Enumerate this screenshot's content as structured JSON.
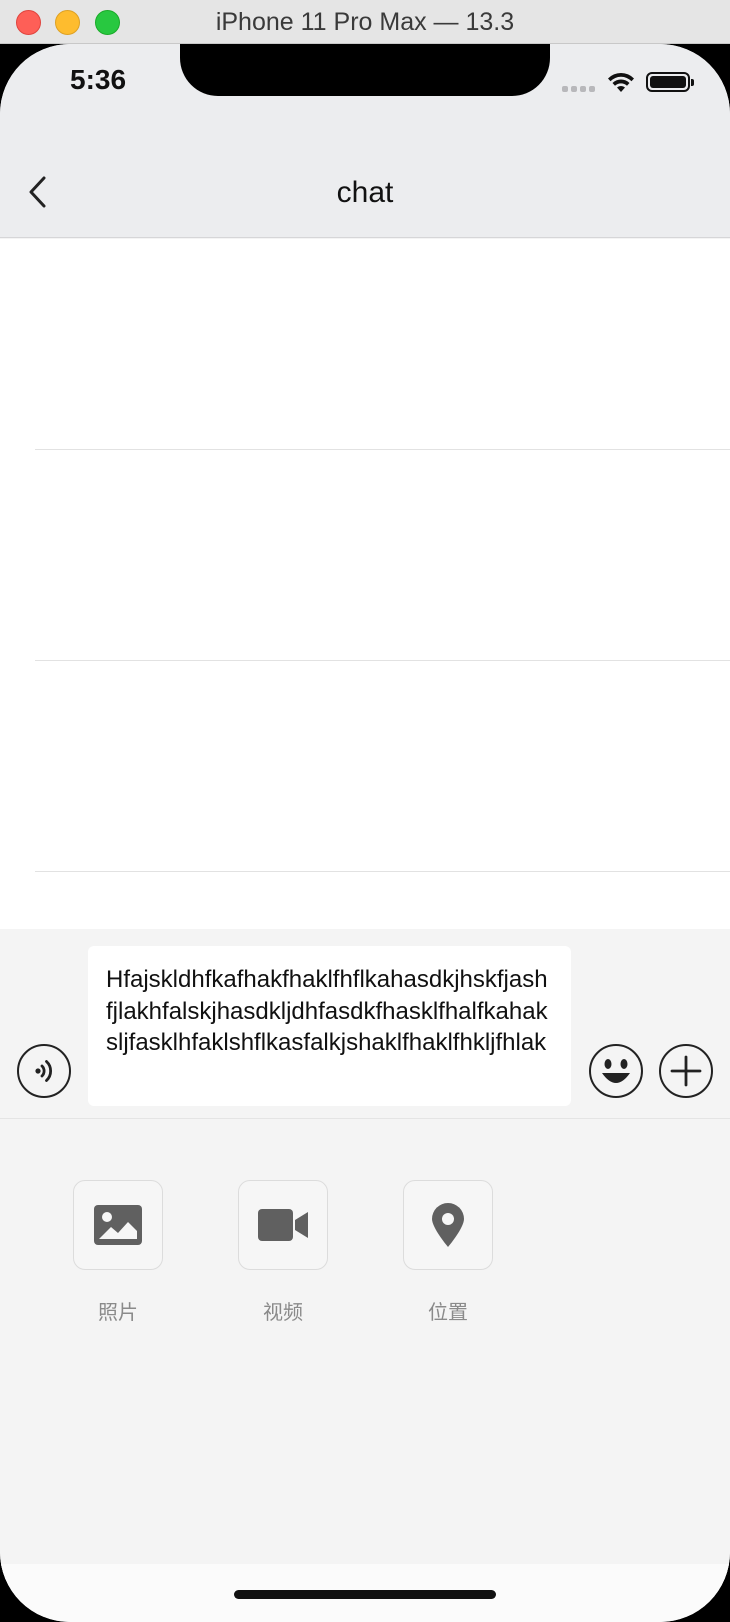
{
  "window": {
    "title": "iPhone 11 Pro Max — 13.3"
  },
  "status_bar": {
    "time": "5:36"
  },
  "nav": {
    "title": "chat",
    "back_icon": "chevron-left-icon"
  },
  "messages": [
    {},
    {},
    {}
  ],
  "composer": {
    "text": "Hfajskldhfkafhakfhaklfhflkahasdkjhskfjashfjlakhfalskjhasdkljdhfasdkfhasklfhalfkahaksljfasklhfaklshflkasfalkjshaklfhaklfhkljfhlak",
    "voice_icon": "voice-icon",
    "emoji_icon": "emoji-icon",
    "plus_icon": "plus-icon"
  },
  "tools": [
    {
      "label": "照片",
      "icon": "photo-icon"
    },
    {
      "label": "视频",
      "icon": "video-icon"
    },
    {
      "label": "位置",
      "icon": "location-icon"
    }
  ],
  "colors": {
    "nav_background": "#ecedef",
    "panel_background": "#f4f4f4",
    "icon_gray": "#606060"
  }
}
